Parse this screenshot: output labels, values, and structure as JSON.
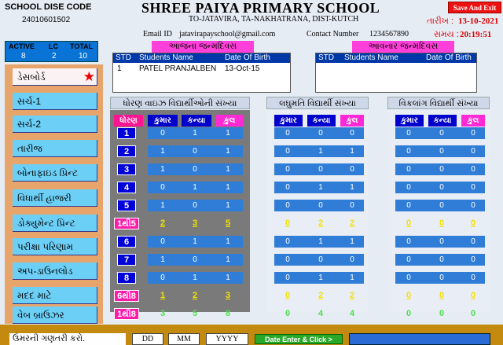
{
  "header": {
    "dise_title": "SCHOOL DISE CODE",
    "dise_code": "24010601502",
    "school_name": "SHREE PAIYA PRIMARY SCHOOL",
    "address": "TO-JATAVIRA, TA-NAKHATRANA, DIST-KUTCH",
    "email_label": "Email ID",
    "email": "jatavirapayschool@gmail.com",
    "contact_label": "Contact Number",
    "contact": "1234567890",
    "save_label": "Save And Exit",
    "date_label": "તારીખ :",
    "date_value": "13-10-2021",
    "time_label": "સમય :",
    "time_value": "20:19:51"
  },
  "counts": {
    "headers": [
      "ACTIVE",
      "LC",
      "TOTAL"
    ],
    "values": [
      "8",
      "2",
      "10"
    ]
  },
  "sidebar": {
    "items": [
      {
        "label": "ડેસબોર્ડ"
      },
      {
        "label": "સર્ચ-1"
      },
      {
        "label": "સર્ચ-2"
      },
      {
        "label": "તારીજ"
      },
      {
        "label": "બોનાફાઇડ પ્રિન્ટ"
      },
      {
        "label": "વિધાર્થી હાજરી"
      },
      {
        "label": "ડોક્યુમેન્ટ પ્રિન્ટ"
      },
      {
        "label": "પરીક્ષા પરિણામ"
      },
      {
        "label": "અપ-ડાઉનલોડ"
      },
      {
        "label": "મદદ માટે"
      },
      {
        "label": "વેબ બ્રાઉઝર"
      }
    ]
  },
  "birthdays": {
    "today_title": "આજના જન્મદિવસ",
    "upcoming_title": "આવનાર જન્મદિવસ",
    "columns": [
      "STD",
      "Students Name",
      "Date Of Birth"
    ],
    "today_rows": [
      {
        "std": "1",
        "name": "PATEL PRANJALBEN",
        "dob": "13-Oct-15"
      }
    ]
  },
  "std_panel": {
    "title": "ધોરણ વાઇઝ વિદ્યાર્થીઓની સંખ્યા",
    "headers": [
      "ધોરણ",
      "કુમાર",
      "કન્યા",
      "કુલ"
    ],
    "rows": [
      {
        "std": "1",
        "boys": "0",
        "girls": "1",
        "total": "1"
      },
      {
        "std": "2",
        "boys": "1",
        "girls": "0",
        "total": "1"
      },
      {
        "std": "3",
        "boys": "1",
        "girls": "0",
        "total": "1"
      },
      {
        "std": "4",
        "boys": "0",
        "girls": "1",
        "total": "1"
      },
      {
        "std": "5",
        "boys": "1",
        "girls": "0",
        "total": "1"
      },
      {
        "std": "1થી5",
        "boys": "2",
        "girls": "3",
        "total": "5",
        "summary": true
      },
      {
        "std": "6",
        "boys": "0",
        "girls": "1",
        "total": "1"
      },
      {
        "std": "7",
        "boys": "1",
        "girls": "0",
        "total": "1"
      },
      {
        "std": "8",
        "boys": "0",
        "girls": "1",
        "total": "1"
      },
      {
        "std": "6થી8",
        "boys": "1",
        "girls": "2",
        "total": "3",
        "summary": true
      },
      {
        "std": "1થી8",
        "boys": "3",
        "girls": "5",
        "total": "8",
        "summary": true,
        "grand": true
      }
    ]
  },
  "poor_panel": {
    "title": "લઘુમતિ વિદ્યાર્થી સંખ્યા",
    "headers": [
      "કુમાર",
      "કન્યા",
      "કુલ"
    ],
    "rows": [
      [
        "0",
        "0",
        "0"
      ],
      [
        "0",
        "1",
        "1"
      ],
      [
        "0",
        "0",
        "0"
      ],
      [
        "0",
        "1",
        "1"
      ],
      [
        "0",
        "0",
        "0"
      ],
      [
        "0",
        "2",
        "2"
      ],
      [
        "0",
        "1",
        "1"
      ],
      [
        "0",
        "0",
        "0"
      ],
      [
        "0",
        "1",
        "1"
      ],
      [
        "0",
        "2",
        "2"
      ],
      [
        "0",
        "4",
        "4"
      ]
    ]
  },
  "dis_panel": {
    "title": "વિકલાંગ વિદ્યાર્થી સંખ્યા",
    "headers": [
      "કુમાર",
      "કન્યા",
      "કુલ"
    ],
    "rows": [
      [
        "0",
        "0",
        "0"
      ],
      [
        "0",
        "0",
        "0"
      ],
      [
        "0",
        "0",
        "0"
      ],
      [
        "0",
        "0",
        "0"
      ],
      [
        "0",
        "0",
        "0"
      ],
      [
        "0",
        "0",
        "0"
      ],
      [
        "0",
        "0",
        "0"
      ],
      [
        "0",
        "0",
        "0"
      ],
      [
        "0",
        "0",
        "0"
      ],
      [
        "0",
        "0",
        "0"
      ],
      [
        "0",
        "0",
        "0"
      ]
    ]
  },
  "footer": {
    "age_label": "ઉંમરની ગણતરી કરો.",
    "dd_placeholder": "DD",
    "mm_placeholder": "MM",
    "yyyy_placeholder": "YYYY",
    "calc_label": "Date Enter & Click >"
  }
}
